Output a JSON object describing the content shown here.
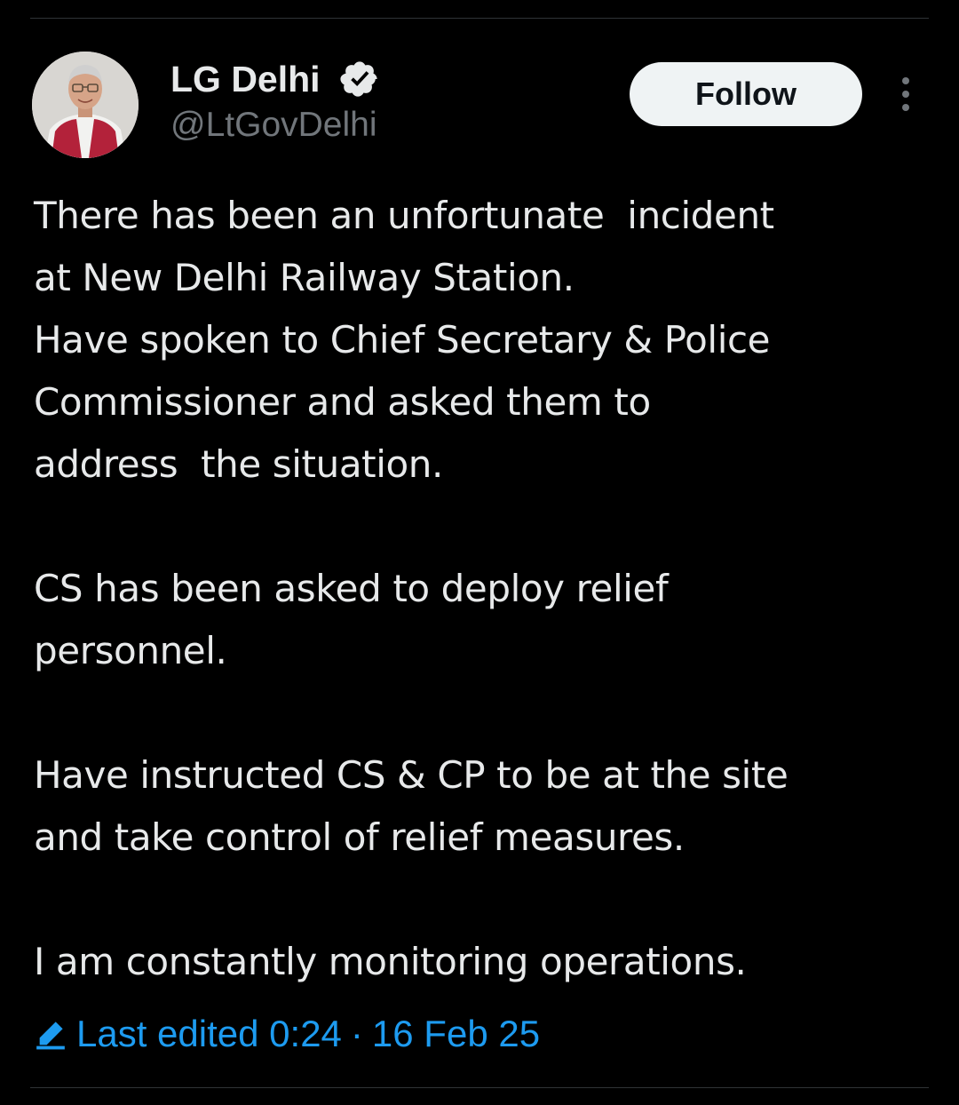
{
  "header": {
    "display_name": "LG Delhi",
    "handle": "@LtGovDelhi",
    "follow_label": "Follow",
    "verified_icon": "verified-badge-icon",
    "more_icon": "more-vertical-icon"
  },
  "tweet": {
    "lines": [
      "There has been an unfortunate  incident",
      "at New Delhi Railway Station.",
      "Have spoken to Chief Secretary & Police",
      "Commissioner and asked them to",
      "address  the situation.",
      "",
      "CS has been asked to deploy relief",
      "personnel.",
      "",
      "Have instructed CS & CP to be at the site",
      "and take control of relief measures.",
      "",
      "I am constantly monitoring operations."
    ]
  },
  "edit_info": {
    "label": "Last edited",
    "time": "0:24",
    "separator": "·",
    "date": "16 Feb 25",
    "icon": "pencil-icon"
  },
  "colors": {
    "background": "#000000",
    "text_primary": "#e7e9ea",
    "text_secondary": "#71767b",
    "accent": "#1d9bf0",
    "follow_button_bg": "#eff3f4",
    "divider": "#2f3336"
  }
}
